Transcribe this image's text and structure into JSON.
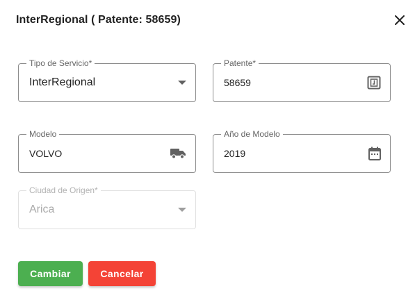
{
  "dialog": {
    "title": "InterRegional ( Patente: 58659)",
    "close_icon": "close-icon"
  },
  "form": {
    "tipo_servicio": {
      "label": "Tipo de Servicio*",
      "value": "InterRegional",
      "icon": "arrow-drop-down-icon"
    },
    "patente": {
      "label": "Patente*",
      "value": "58659",
      "icon": "license-plate-icon"
    },
    "modelo": {
      "label": "Modelo",
      "value": "VOLVO",
      "icon": "truck-icon"
    },
    "anio_modelo": {
      "label": "Año de Modelo",
      "value": "2019",
      "icon": "calendar-icon"
    },
    "ciudad_origen": {
      "label": "Ciudad de Origen*",
      "value": "Arica",
      "icon": "arrow-drop-down-icon",
      "disabled": true
    }
  },
  "actions": {
    "cambiar_label": "Cambiar",
    "cancelar_label": "Cancelar"
  },
  "colors": {
    "confirm": "#4caf50",
    "cancel": "#f44336",
    "icon": "#616161"
  }
}
